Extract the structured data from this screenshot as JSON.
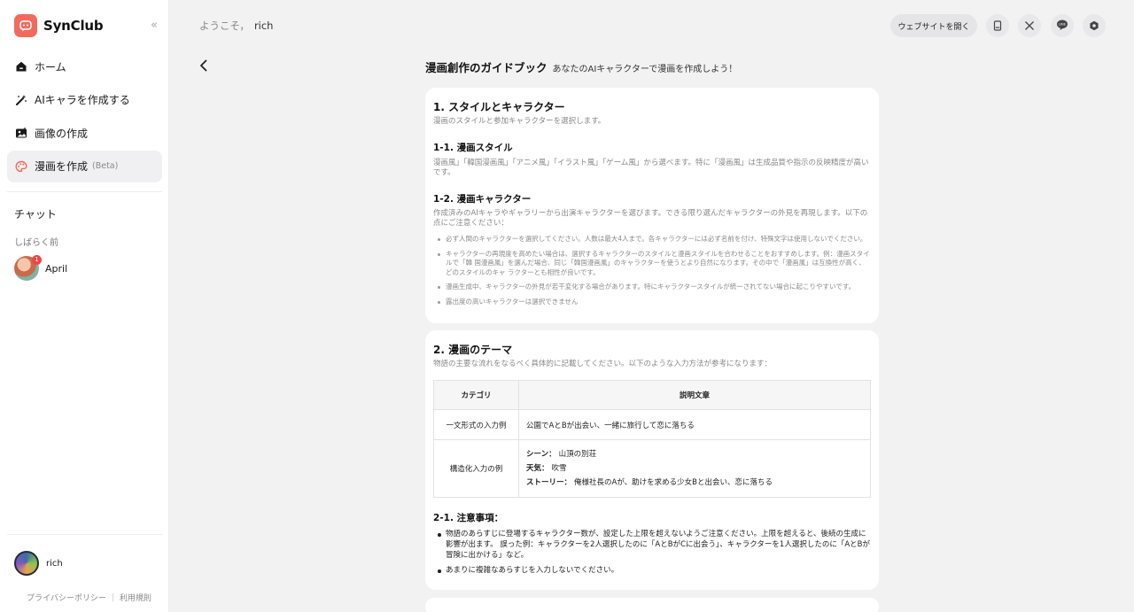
{
  "app": {
    "name": "SynClub"
  },
  "sidebar": {
    "items": [
      {
        "label": "ホーム",
        "icon": "home-icon"
      },
      {
        "label": "AIキャラを作成する",
        "icon": "magic-wand-icon"
      },
      {
        "label": "画像の作成",
        "icon": "image-icon"
      },
      {
        "label": "漫画を作成",
        "badge": "(Beta)",
        "icon": "palette-icon"
      }
    ],
    "chat_title": "チャット",
    "chat_section": "しばらく前",
    "chats": [
      {
        "name": "April",
        "unread": "1"
      }
    ],
    "user": {
      "name": "rich"
    },
    "footer": {
      "privacy": "プライバシーポリシー",
      "terms": "利用規則"
    }
  },
  "header": {
    "welcome": "ようこそ，",
    "username": "rich",
    "open_site": "ウェブサイトを開く",
    "icons": [
      "mobile-icon",
      "x-logo-icon",
      "line-icon",
      "discord-icon"
    ]
  },
  "page": {
    "title": "漫画創作のガイドブック",
    "subtitle": "あなたのAIキャラクターで漫画を作成しよう！"
  },
  "section1": {
    "heading": "1. スタイルとキャラクター",
    "desc": "漫画のスタイルと参加キャラクターを選択します。",
    "sub1_title": "1-1. 漫画スタイル",
    "sub1_desc": "漫画風」「韓国漫画風」「アニメ風」「イラスト風」「ゲーム風」から選べます。特に「漫画風」は生成品質や指示の反映精度が高いです。",
    "sub2_title": "1-2. 漫画キャラクター",
    "sub2_desc": "作成済みのAIキャラやギャラリーから出演キャラクターを選びます。できる限り選んだキャラクターの外見を再現します。以下の点にご注意ください：",
    "bullets": [
      "必ず人間のキャラクターを選択してください。人数は最大4人まで。各キャラクターには必ず名前を付け、特殊文字は使用しないでください。",
      "キャラクターの再現度を高めたい場合は、選択するキャラクターのスタイルと漫画スタイルを合わせることをおすすめします。例：漫画スタイルで「韓 国漫画風」を選んだ場合、同じ「韓国漫画風」のキャラクターを使うとより自然になります。その中で「漫画風」は互換性が高く、どのスタイルのキャ ラクターとも相性が良いです。",
      "漫画生成中、キャラクターの外見が若干変化する場合があります。特にキャラクタースタイルが統一されてない場合に起こりやすいです。",
      "露出度の高いキャラクターは選択できません"
    ]
  },
  "section2": {
    "heading": "2. 漫画のテーマ",
    "desc": "物語の主要な流れをなるべく具体的に記載してください。以下のような入力方法が参考になります：",
    "table": {
      "headers": [
        "カテゴリ",
        "説明文章"
      ],
      "row1": {
        "category": "一文形式の入力例",
        "text": "公園でAとBが出会い、一緒に旅行して恋に落ちる"
      },
      "row2": {
        "category": "構造化入力の例",
        "scene_label": "シーン：",
        "scene": "山頂の別荘",
        "weather_label": "天気：",
        "weather": "吹雪",
        "story_label": "ストーリー：",
        "story": "俺様社長のAが、助けを求める少女Bと出会い、恋に落ちる"
      }
    },
    "notes_title": "2-1. 注意事項：",
    "notes": [
      "物語のあらすじに登場するキャラクター数が、設定した上限を超えないようご注意ください。上限を超えると、後続の生成に影響が出ます。 誤った例：キャラクターを2人選択したのに「AとBがCに出会う」、キャラクターを1人選択したのに「AとBが冒険に出かける」など。",
      "あまりに複雑なあらすじを入力しないでください。"
    ]
  },
  "colors": {
    "brand": "#f26a5b",
    "badge": "#ee4444"
  }
}
